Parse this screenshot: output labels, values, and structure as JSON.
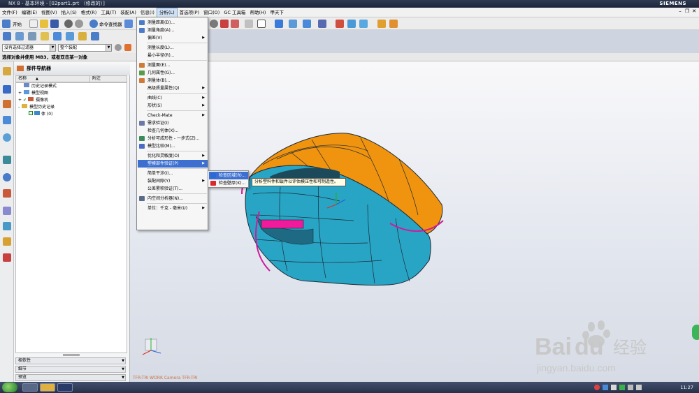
{
  "window": {
    "title": "NX 8 - 基本环境 - [02part1.prt （修改的）]",
    "brand": "SIEMENS"
  },
  "menubar": [
    "文件(F)",
    "编辑(E)",
    "视图(V)",
    "插入(S)",
    "格式(R)",
    "工具(T)",
    "装配(A)",
    "信息(I)",
    "分析(L)",
    "首选项(P)",
    "窗口(O)",
    "GC 工具箱",
    "帮助(H)",
    "甲天下"
  ],
  "menubar_active": "分析(L)",
  "toolbar": {
    "start_label": "开始",
    "command_finder_label": "命令查找器"
  },
  "filter": {
    "type_value": "没有选择过滤器",
    "scope_value": "整个装配"
  },
  "prompt": "选择对象并使用 MB3，或者双击某一对象",
  "navigator": {
    "title": "部件导航器",
    "columns": [
      "名称",
      "附注"
    ],
    "tree": [
      {
        "label": "历史记录模式",
        "indent": 0
      },
      {
        "label": "模型视图",
        "indent": 0,
        "toggle": "+"
      },
      {
        "label": "摄像机",
        "indent": 0,
        "toggle": "+"
      },
      {
        "label": "模型历史记录",
        "indent": 0,
        "toggle": "-"
      },
      {
        "label": "体 (0)",
        "indent": 1
      }
    ],
    "sections": [
      "相依性",
      "细节",
      "预览"
    ]
  },
  "analysis_menu": [
    {
      "label": "测量距离(D)...",
      "icon": "measure-distance-icon",
      "color": "#4a7cc8"
    },
    {
      "label": "测量角度(A)...",
      "icon": "measure-angle-icon",
      "color": "#4a7cc8"
    },
    {
      "label": "偏差(V)",
      "submenu": true
    },
    {
      "sep": true
    },
    {
      "label": "测量长度(L)..."
    },
    {
      "label": "最小半径(R)..."
    },
    {
      "sep": true
    },
    {
      "label": "测量面(E)...",
      "icon": "measure-face-icon",
      "color": "#d07a3a"
    },
    {
      "label": "几何属性(G)...",
      "icon": "geometric-properties-icon",
      "color": "#5a9a4a"
    },
    {
      "label": "测量体(B)...",
      "icon": "measure-body-icon",
      "color": "#d07a3a"
    },
    {
      "label": "高级质量属性(Q)",
      "submenu": true
    },
    {
      "sep": true
    },
    {
      "label": "曲线(C)",
      "submenu": true
    },
    {
      "label": "形状(S)",
      "submenu": true
    },
    {
      "sep": true
    },
    {
      "label": "Check-Mate",
      "submenu": true
    },
    {
      "label": "需求验证(I)",
      "icon": "requirements-icon",
      "color": "#6a7aa8"
    },
    {
      "label": "检查几何体(X)..."
    },
    {
      "label": "分析可成形性 - 一步式(Z)...",
      "icon": "formability-icon",
      "color": "#3a8a5a"
    },
    {
      "label": "模型比较(M)...",
      "icon": "model-compare-icon",
      "color": "#4a6ac8"
    },
    {
      "sep": true
    },
    {
      "label": "优化和灵敏度(O)",
      "submenu": true
    },
    {
      "label": "塑模部件验证(P)",
      "submenu": true,
      "highlight": true
    },
    {
      "sep": true
    },
    {
      "label": "简单干涉(I)..."
    },
    {
      "label": "装配间隙(Y)",
      "submenu": true
    },
    {
      "label": "公差累积验证(T)..."
    },
    {
      "sep": true
    },
    {
      "label": "内空间分析器(N)...",
      "icon": "inner-space-icon",
      "color": "#5a6a8a"
    },
    {
      "sep": true
    },
    {
      "label": "单位：千克 - 毫米(U)",
      "submenu": true
    }
  ],
  "submenu": [
    {
      "label": "检查区域(R)...",
      "highlight": true
    },
    {
      "label": "检查壁厚(K)..."
    }
  ],
  "tooltip": "分析塑料件和钣件以评估模压性和可制造性。",
  "viewport": {
    "label": "TFR-TRI WORK Camera TFR-TRI"
  },
  "watermark": {
    "brand": "Bai",
    "brand2": "du",
    "cn": "经验",
    "url": "jingyan.baidu.com"
  },
  "taskbar": {
    "clock": "11:27"
  }
}
